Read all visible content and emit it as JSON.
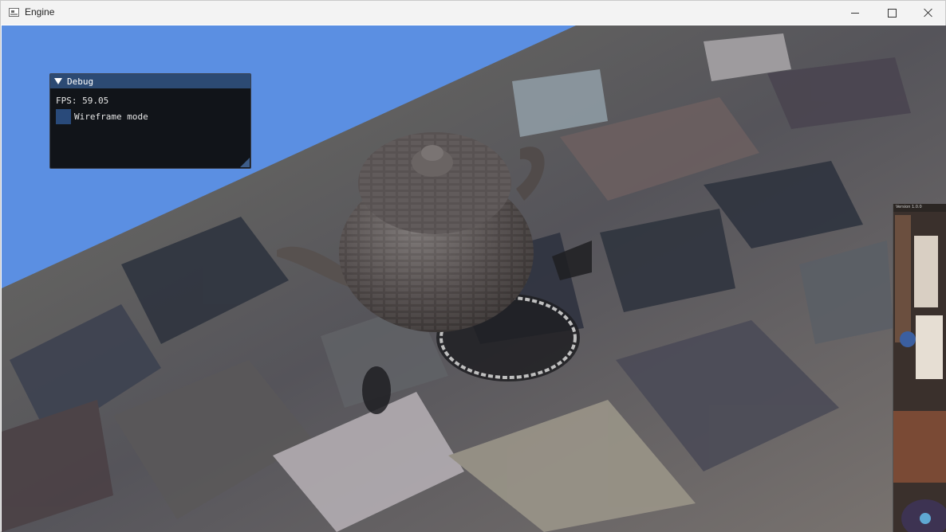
{
  "window": {
    "title": "Engine",
    "icon": "app-window-icon",
    "controls": {
      "minimize": "minimize-icon",
      "maximize": "maximize-icon",
      "close": "close-icon"
    }
  },
  "viewport": {
    "sky_color": "#5b8fe2",
    "object": "teapot",
    "ground": "cobblestone"
  },
  "debug_panel": {
    "title": "Debug",
    "fps_text": "FPS: 59.05",
    "wireframe_label": "Wireframe mode",
    "wireframe_checked": false,
    "header_color": "#2c4a73",
    "checkbox_color": "#294a7a"
  },
  "side_panel": {
    "label": "Version 1.0.0"
  }
}
